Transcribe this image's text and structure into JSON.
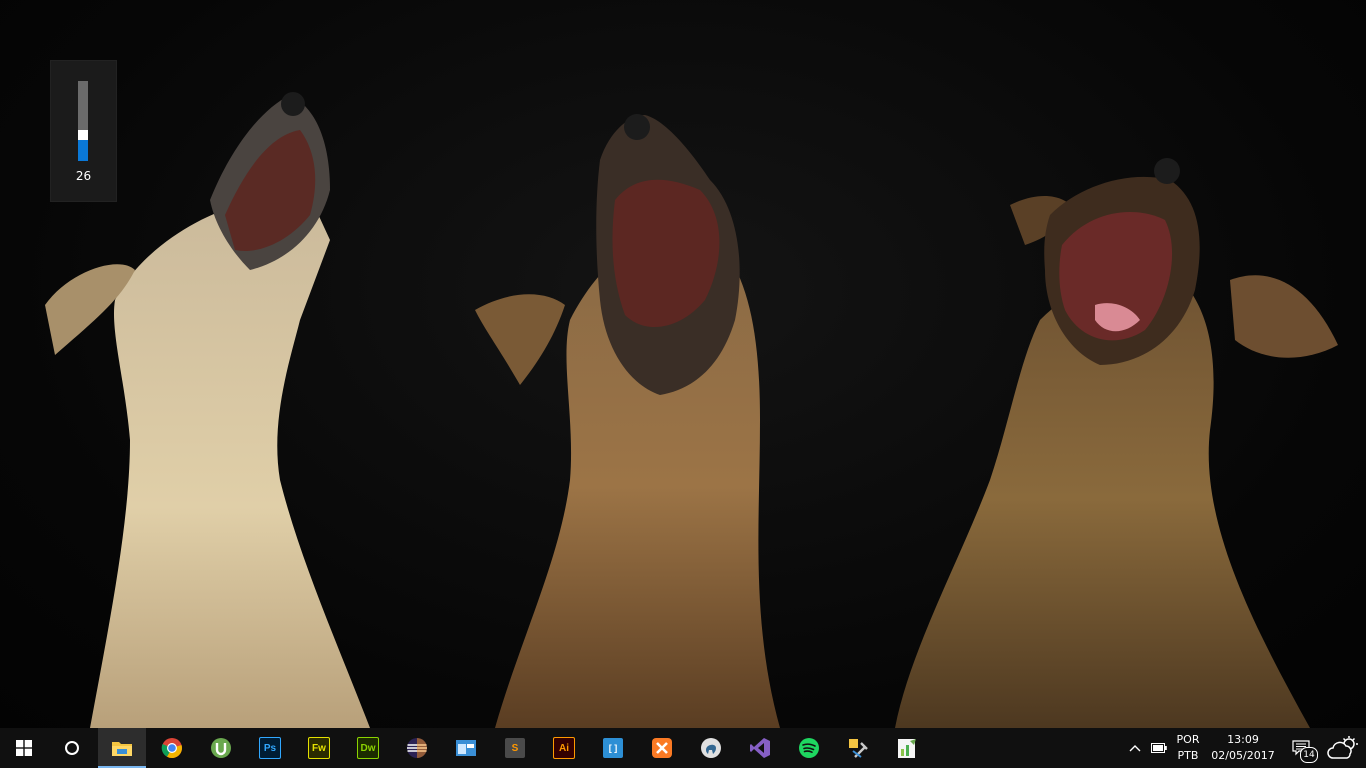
{
  "volume": {
    "value_label": "26",
    "level": 0.26
  },
  "taskbar": {
    "start": {
      "icon": "windows-logo-icon"
    },
    "search": {
      "icon": "cortana-circle-icon"
    },
    "apps": [
      {
        "name": "file-explorer",
        "icon": "folder-icon",
        "color": "#f4c542",
        "active": true
      },
      {
        "name": "google-chrome",
        "icon": "chrome-icon",
        "color": "#db4437"
      },
      {
        "name": "utorrent",
        "icon": "utorrent-icon",
        "color": "#6aa84f"
      },
      {
        "name": "photoshop",
        "icon": "photoshop-icon",
        "label": "Ps",
        "color": "#31a8ff",
        "bg": "#001d34"
      },
      {
        "name": "fireworks",
        "icon": "fireworks-icon",
        "label": "Fw",
        "color": "#e4e100",
        "bg": "#2b2b00"
      },
      {
        "name": "dreamweaver",
        "icon": "dreamweaver-icon",
        "label": "Dw",
        "color": "#8bd300",
        "bg": "#1c2b00"
      },
      {
        "name": "eclipse",
        "icon": "eclipse-icon",
        "color": "#2c2255"
      },
      {
        "name": "control-panel",
        "icon": "window-app-icon",
        "color": "#3a8fd6"
      },
      {
        "name": "sublime-text",
        "icon": "sublime-icon",
        "label": "S",
        "color": "#ff9800",
        "bg": "#4a4a4a"
      },
      {
        "name": "illustrator",
        "icon": "illustrator-icon",
        "label": "Ai",
        "color": "#ff9a00",
        "bg": "#330000"
      },
      {
        "name": "brackets",
        "icon": "brackets-icon",
        "label": "[ ]",
        "color": "#ffffff",
        "bg": "#2d8fd5"
      },
      {
        "name": "xampp",
        "icon": "xampp-icon",
        "color": "#fb7a24"
      },
      {
        "name": "pgadmin",
        "icon": "elephant-icon",
        "color": "#e0e0e0"
      },
      {
        "name": "visual-studio",
        "icon": "visual-studio-icon",
        "color": "#865fc5"
      },
      {
        "name": "spotify",
        "icon": "spotify-icon",
        "color": "#1ed760"
      },
      {
        "name": "tools",
        "icon": "tools-icon",
        "color": "#c9c9c9"
      },
      {
        "name": "notepad",
        "icon": "notepad-chart-icon",
        "color": "#8bc34a"
      }
    ],
    "tray": {
      "chevron_icon": "chevron-up-icon",
      "battery_icon": "battery-icon",
      "language": "POR",
      "layout": "PTB",
      "time": "13:09",
      "date": "02/05/2017",
      "notification_icon": "action-center-icon",
      "notification_count": "14",
      "weather_icon": "partly-cloudy-icon"
    }
  }
}
